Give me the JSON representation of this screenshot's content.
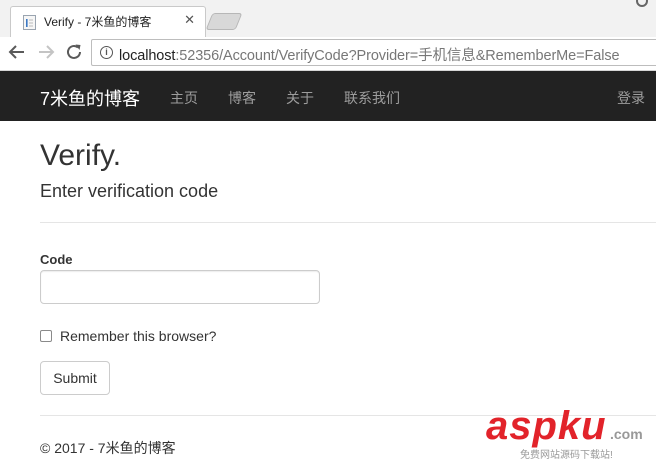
{
  "browser": {
    "tab_title": "Verify - 7米鱼的博客",
    "tab_close_glyph": "✕",
    "url_host": "localhost",
    "url_rest": ":52356/Account/VerifyCode?Provider=手机信息&RememberMe=False",
    "info_glyph": "i"
  },
  "navbar": {
    "brand": "7米鱼的博客",
    "links": [
      "主页",
      "博客",
      "关于",
      "联系我们"
    ],
    "login": "登录"
  },
  "page": {
    "title": "Verify.",
    "subtitle": "Enter verification code"
  },
  "form": {
    "code_label": "Code",
    "code_value": "",
    "remember_label": "Remember this browser?",
    "remember_checked": false,
    "submit_label": "Submit"
  },
  "footer": {
    "text": "© 2017 - 7米鱼的博客"
  },
  "watermark": {
    "main": "aspku",
    "domain": ".com",
    "sub": "免费网站源码下载站!"
  },
  "colors": {
    "navbar_bg": "#222222",
    "nav_link": "#9d9d9d",
    "brand": "#ffffff",
    "watermark_red": "#e2232a"
  }
}
